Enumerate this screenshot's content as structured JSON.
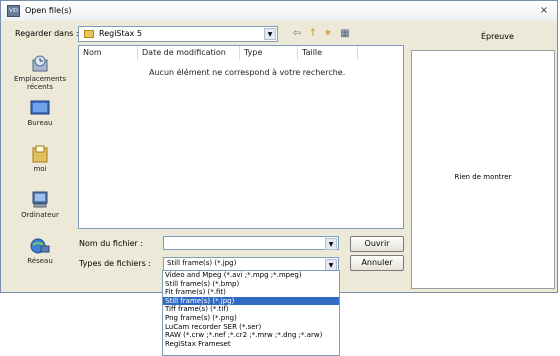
{
  "window": {
    "title": "Open file(s)",
    "close_glyph": "×",
    "app_icon_text": "VID"
  },
  "lookin": {
    "label": "Regarder dans :",
    "value": "RegiStax 5"
  },
  "toolbar": {
    "back_glyph": "⇦",
    "up_glyph": "↑",
    "newfolder_glyph": "✶",
    "views_glyph": "▦"
  },
  "places": [
    {
      "label": "Emplacements récents",
      "icon": "recent-places-icon"
    },
    {
      "label": "Bureau",
      "icon": "desktop-icon"
    },
    {
      "label": "moi",
      "icon": "user-folder-icon"
    },
    {
      "label": "Ordinateur",
      "icon": "computer-icon"
    },
    {
      "label": "Réseau",
      "icon": "network-icon"
    }
  ],
  "filelist": {
    "columns": [
      "Nom",
      "Date de modification",
      "Type",
      "Taille"
    ],
    "empty_message": "Aucun élément ne correspond à votre recherche."
  },
  "preview": {
    "label": "Épreuve",
    "message": "Rien de montrer"
  },
  "filename": {
    "label": "Nom du fichier :",
    "value": ""
  },
  "filetype": {
    "label": "Types de fichiers :",
    "value": "Still frame(s) (*.jpg)",
    "options": [
      "Video and Mpeg (*.avi ;*.mpg ;*.mpeg)",
      "Still frame(s) (*.bmp)",
      "Fit frame(s) (*.fit)",
      "Still frame(s) (*.jpg)",
      "Tiff frame(s) (*.tif)",
      "Png frame(s) (*.png)",
      "LuCam recorder SER (*.ser)",
      "RAW (*.crw ;*.nef ;*.cr2 ;*.mrw ;*.dng ;*.arw)",
      "RegiStax Frameset"
    ],
    "selected_index": 3
  },
  "buttons": {
    "open": "Ouvrir",
    "cancel": "Annuler"
  },
  "colors": {
    "selection": "#316ac5",
    "dialog_bg": "#ece9d8"
  }
}
